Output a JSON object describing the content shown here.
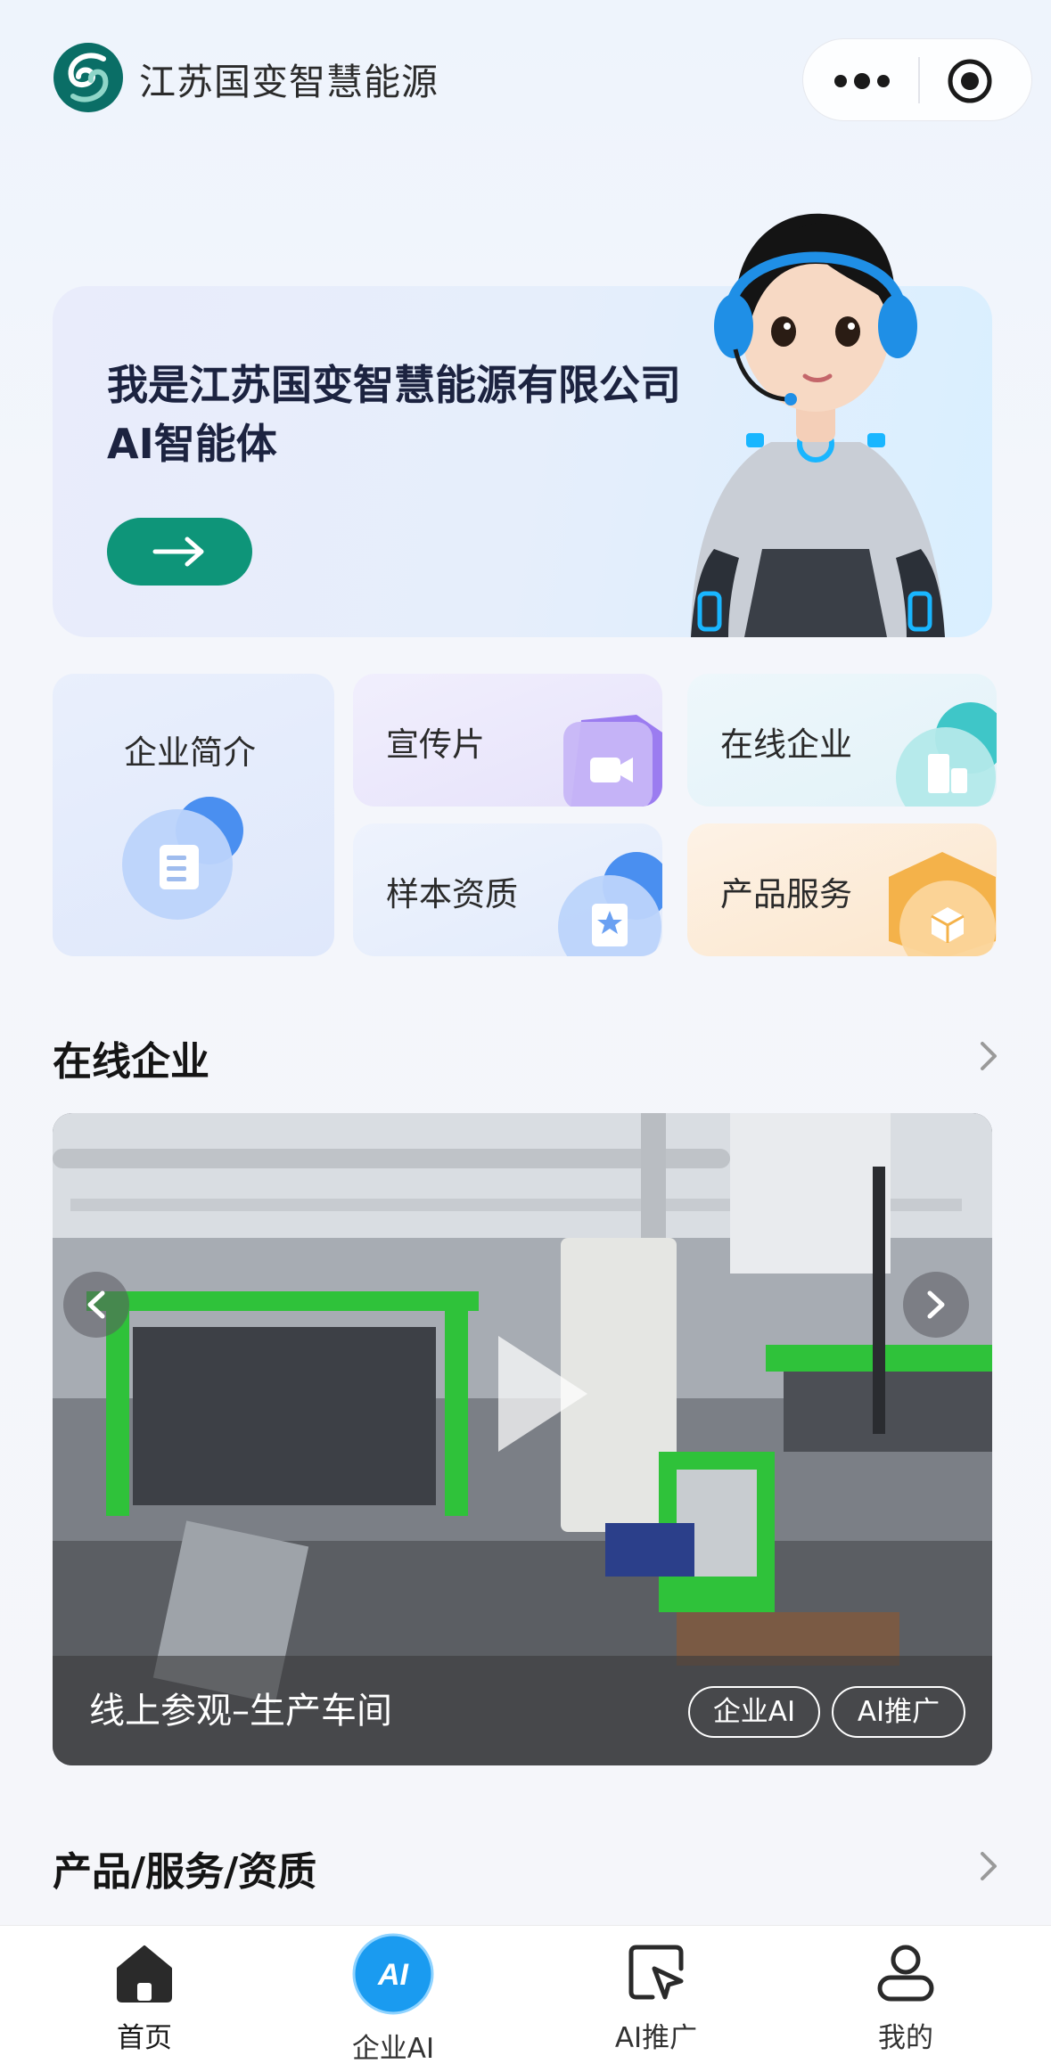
{
  "header": {
    "brand_name": "江苏国变智慧能源",
    "logo_icon": "company-logo-icon",
    "more_icon": "more-dots-icon",
    "close_icon": "target-circle-icon"
  },
  "hero": {
    "title": "我是江苏国变智慧能源有限公司AI智能体",
    "button_icon": "arrow-right-icon"
  },
  "grid": {
    "intro": "企业简介",
    "promo_video": "宣传片",
    "online_company": "在线企业",
    "sample_qualification": "样本资质",
    "products_services": "产品服务"
  },
  "online_section": {
    "title": "在线企业",
    "video_caption": "线上参观–生产车间",
    "tags": [
      "企业AI",
      "AI推广"
    ]
  },
  "products_section": {
    "title": "产品/服务/资质"
  },
  "tabbar": {
    "items": [
      {
        "label": "首页",
        "icon": "home-icon"
      },
      {
        "label": "企业AI",
        "icon": "ai-badge-icon"
      },
      {
        "label": "AI推广",
        "icon": "cursor-window-icon"
      },
      {
        "label": "我的",
        "icon": "user-icon"
      }
    ]
  },
  "colors": {
    "accent": "#0e9579",
    "ai_badge": "#1a9bf0"
  }
}
